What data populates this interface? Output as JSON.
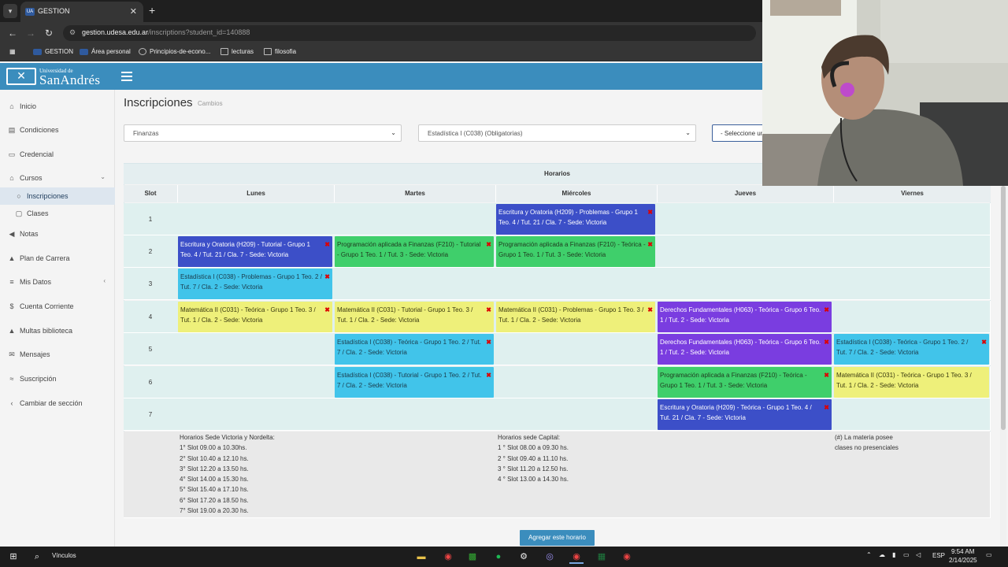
{
  "browser": {
    "tab_title": "GESTION",
    "tab_fav": "UA",
    "tab_close": "✕",
    "new_tab": "+",
    "url_host": "gestion.udesa.edu.ar",
    "url_path": "/inscriptions?student_id=140888",
    "bookmarks": [
      {
        "label": "GESTION",
        "icon": "udesa-icon"
      },
      {
        "label": "Área personal",
        "icon": "udesa-icon"
      },
      {
        "label": "Principios-de-econo...",
        "icon": "globe-icon"
      },
      {
        "label": "lecturas",
        "icon": "folder-icon"
      },
      {
        "label": "filosofia",
        "icon": "folder-icon"
      }
    ]
  },
  "app": {
    "logo_small": "Universidad de",
    "logo_name": "SanAndrés",
    "logo_crest": "✕"
  },
  "sidebar": {
    "items": [
      {
        "label": "Inicio",
        "icon": "home-icon",
        "glyph": "⌂"
      },
      {
        "label": "Condiciones",
        "icon": "document-icon",
        "glyph": "▤"
      },
      {
        "label": "Credencial",
        "icon": "id-card-icon",
        "glyph": "▭"
      },
      {
        "label": "Cursos",
        "icon": "bank-icon",
        "glyph": "⌂"
      },
      {
        "label": "Inscripciones",
        "icon": "circle-icon",
        "glyph": "○"
      },
      {
        "label": "Clases",
        "icon": "calendar-icon",
        "glyph": "▢"
      },
      {
        "label": "Notas",
        "icon": "megaphone-icon",
        "glyph": "◀"
      },
      {
        "label": "Plan de Carrera",
        "icon": "graduation-cap-icon",
        "glyph": "▲"
      },
      {
        "label": "Mis Datos",
        "icon": "list-icon",
        "glyph": "≡"
      },
      {
        "label": "Cuenta Corriente",
        "icon": "dollar-icon",
        "glyph": "$"
      },
      {
        "label": "Multas biblioteca",
        "icon": "warning-icon",
        "glyph": "▲"
      },
      {
        "label": "Mensajes",
        "icon": "envelope-icon",
        "glyph": "✉"
      },
      {
        "label": "Suscripción",
        "icon": "rss-icon",
        "glyph": "≈"
      },
      {
        "label": "Cambiar de sección",
        "icon": "chevron-left-icon",
        "glyph": "‹"
      }
    ]
  },
  "page": {
    "title": "Inscripciones",
    "subtitle": "Cambios",
    "select_career": "Finanzas",
    "select_subject": "Estadística I (C038) (Obligatorias)",
    "select_extra": "- Seleccione un",
    "add_button": "Agregar este horario"
  },
  "schedule": {
    "title": "Horarios",
    "slot_header": "Slot",
    "days": [
      "Lunes",
      "Martes",
      "Miércoles",
      "Jueves",
      "Viernes"
    ],
    "slots": [
      "1",
      "2",
      "3",
      "4",
      "5",
      "6",
      "7"
    ],
    "blocks": [
      {
        "day": 2,
        "slot": 0,
        "color": "#3c4fc8",
        "text_color": "#ffffff",
        "text": "Escritura y Oratoria (H209) - Problemas - Grupo 1 Teo. 4 / Tut. 21 / Cla. 7 - Sede: Victoria"
      },
      {
        "day": 0,
        "slot": 1,
        "color": "#3c4fc8",
        "text_color": "#ffffff",
        "text": "Escritura y Oratoria (H209) - Tutorial - Grupo 1 Teo. 4 / Tut. 21 / Cla. 7 - Sede: Victoria"
      },
      {
        "day": 1,
        "slot": 1,
        "color": "#3fcf6b",
        "text_color": "#1f3a1f",
        "text": "Programación aplicada a Finanzas (F210) - Tutorial - Grupo 1 Teo. 1 / Tut. 3 - Sede: Victoria"
      },
      {
        "day": 2,
        "slot": 1,
        "color": "#3fcf6b",
        "text_color": "#1f3a1f",
        "text": "Programación aplicada a Finanzas (F210) - Teórica - Grupo 1 Teo. 1 / Tut. 3 - Sede: Victoria"
      },
      {
        "day": 0,
        "slot": 2,
        "color": "#41c4ea",
        "text_color": "#1b3b4b",
        "text": "Estadística I (C038) - Problemas - Grupo 1 Teo. 2 / Tut. 7 / Cla. 2 - Sede: Victoria"
      },
      {
        "day": 0,
        "slot": 3,
        "color": "#eef07a",
        "text_color": "#3a3a10",
        "text": "Matemática II (C031) - Teórica - Grupo 1 Teo. 3 / Tut. 1 / Cla. 2 - Sede: Victoria"
      },
      {
        "day": 1,
        "slot": 3,
        "color": "#eef07a",
        "text_color": "#3a3a10",
        "text": "Matemática II (C031) - Tutorial - Grupo 1 Teo. 3 / Tut. 1 / Cla. 2 - Sede: Victoria"
      },
      {
        "day": 2,
        "slot": 3,
        "color": "#eef07a",
        "text_color": "#3a3a10",
        "text": "Matemática II (C031) - Problemas - Grupo 1 Teo. 3 / Tut. 1 / Cla. 2 - Sede: Victoria"
      },
      {
        "day": 3,
        "slot": 3,
        "color": "#7a3de0",
        "text_color": "#ffffff",
        "text": "Derechos Fundamentales (H063) - Teórica - Grupo 6 Teo. 1 / Tut. 2 - Sede: Victoria"
      },
      {
        "day": 1,
        "slot": 4,
        "color": "#41c4ea",
        "text_color": "#1b3b4b",
        "text": "Estadística I (C038) - Teórica - Grupo 1 Teo. 2 / Tut. 7 / Cla. 2 - Sede: Victoria"
      },
      {
        "day": 3,
        "slot": 4,
        "color": "#7a3de0",
        "text_color": "#ffffff",
        "text": "Derechos Fundamentales (H063) - Teórica - Grupo 6 Teo. 1 / Tut. 2 - Sede: Victoria"
      },
      {
        "day": 4,
        "slot": 4,
        "color": "#41c4ea",
        "text_color": "#1b3b4b",
        "text": "Estadística I (C038) - Teórica - Grupo 1 Teo. 2 / Tut. 7 / Cla. 2 - Sede: Victoria"
      },
      {
        "day": 1,
        "slot": 5,
        "color": "#41c4ea",
        "text_color": "#1b3b4b",
        "text": "Estadística I (C038) - Tutorial - Grupo 1 Teo. 2 / Tut. 7 / Cla. 2 - Sede: Victoria"
      },
      {
        "day": 3,
        "slot": 5,
        "color": "#3fcf6b",
        "text_color": "#1f3a1f",
        "text": "Programación aplicada a Finanzas (F210) - Teórica - Grupo 1 Teo. 1 / Tut. 3 - Sede: Victoria"
      },
      {
        "day": 4,
        "slot": 5,
        "color": "#eef07a",
        "text_color": "#3a3a10",
        "text": "Matemática II (C031) - Teórica - Grupo 1 Teo. 3 / Tut. 1 / Cla. 2 - Sede: Victoria",
        "no_delete": true
      },
      {
        "day": 3,
        "slot": 6,
        "color": "#3c4fc8",
        "text_color": "#ffffff",
        "text": "Escritura y Oratoria (H209) - Teórica - Grupo 1 Teo. 4 / Tut. 21 / Cla. 7 - Sede: Victoria"
      }
    ],
    "delete_glyph": "✖",
    "info_victoria": "Horarios Sede Victoria y Nordelta:\n1° Slot 09.00 a 10.30hs.\n2° Slot 10.40 a 12.10 hs.\n3° Slot 12.20 a 13.50 hs.\n4° Slot 14.00 a 15.30 hs.\n5° Slot 15.40 a 17.10 hs.\n6° Slot 17.20 a 18.50 hs.\n7° Slot 19.00 a 20.30 hs.",
    "info_capital": "Horarios sede Capital:\n1 ° Slot 08.00 a 09.30 hs.\n2 ° Slot 09.40 a 11.10 hs.\n3 ° Slot 11.20 a 12.50 hs.\n4 ° Slot 13.00 a 14.30 hs.",
    "info_note": "(#) La materia posee\nclases no presenciales"
  },
  "taskbar": {
    "search_label": "Vínculos",
    "lang": "ESP",
    "time": "9:54 AM",
    "date": "2/14/2025"
  },
  "colors": {
    "header": "#3b8dbd",
    "grid_bg": "#dff0ef"
  }
}
